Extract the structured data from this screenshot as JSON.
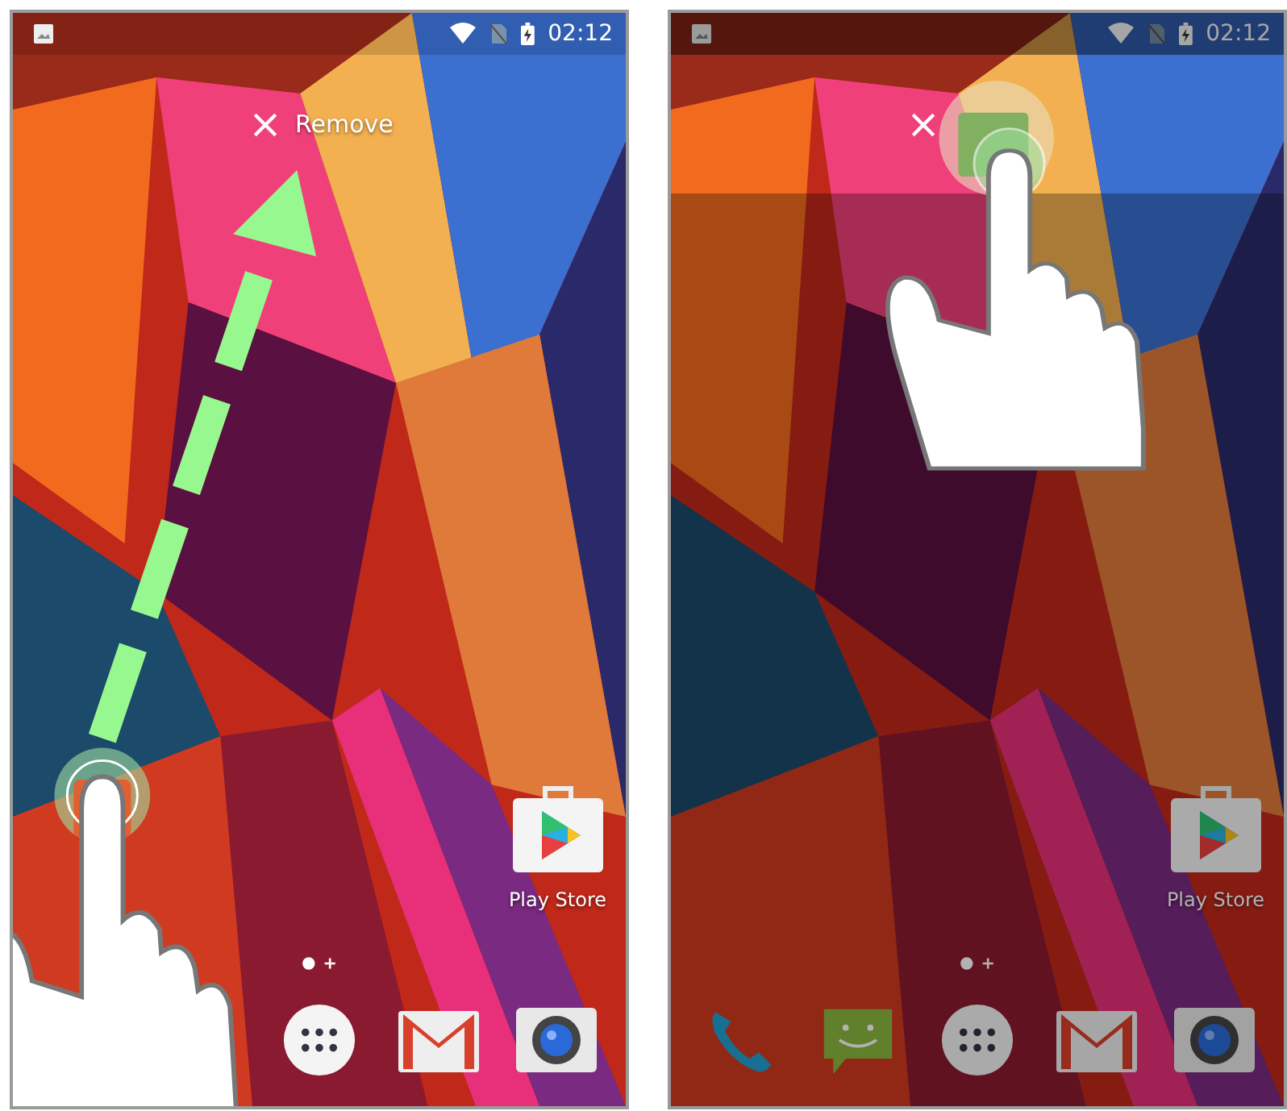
{
  "screens": [
    {
      "dimmed": false,
      "status_bar": {
        "time": "02:12"
      },
      "remove_target": {
        "label": "Remove"
      },
      "apps": [
        {
          "kind": "play-store",
          "label": "Play Store"
        }
      ],
      "dock": [
        {
          "kind": "apps"
        },
        {
          "kind": "gmail"
        },
        {
          "kind": "camera"
        }
      ]
    },
    {
      "dimmed": true,
      "status_bar": {
        "time": "02:12"
      },
      "apps": [
        {
          "kind": "play-store",
          "label": "Play Store"
        }
      ],
      "dock": [
        {
          "kind": "phone"
        },
        {
          "kind": "messages"
        },
        {
          "kind": "apps"
        },
        {
          "kind": "gmail"
        },
        {
          "kind": "camera"
        }
      ]
    }
  ]
}
